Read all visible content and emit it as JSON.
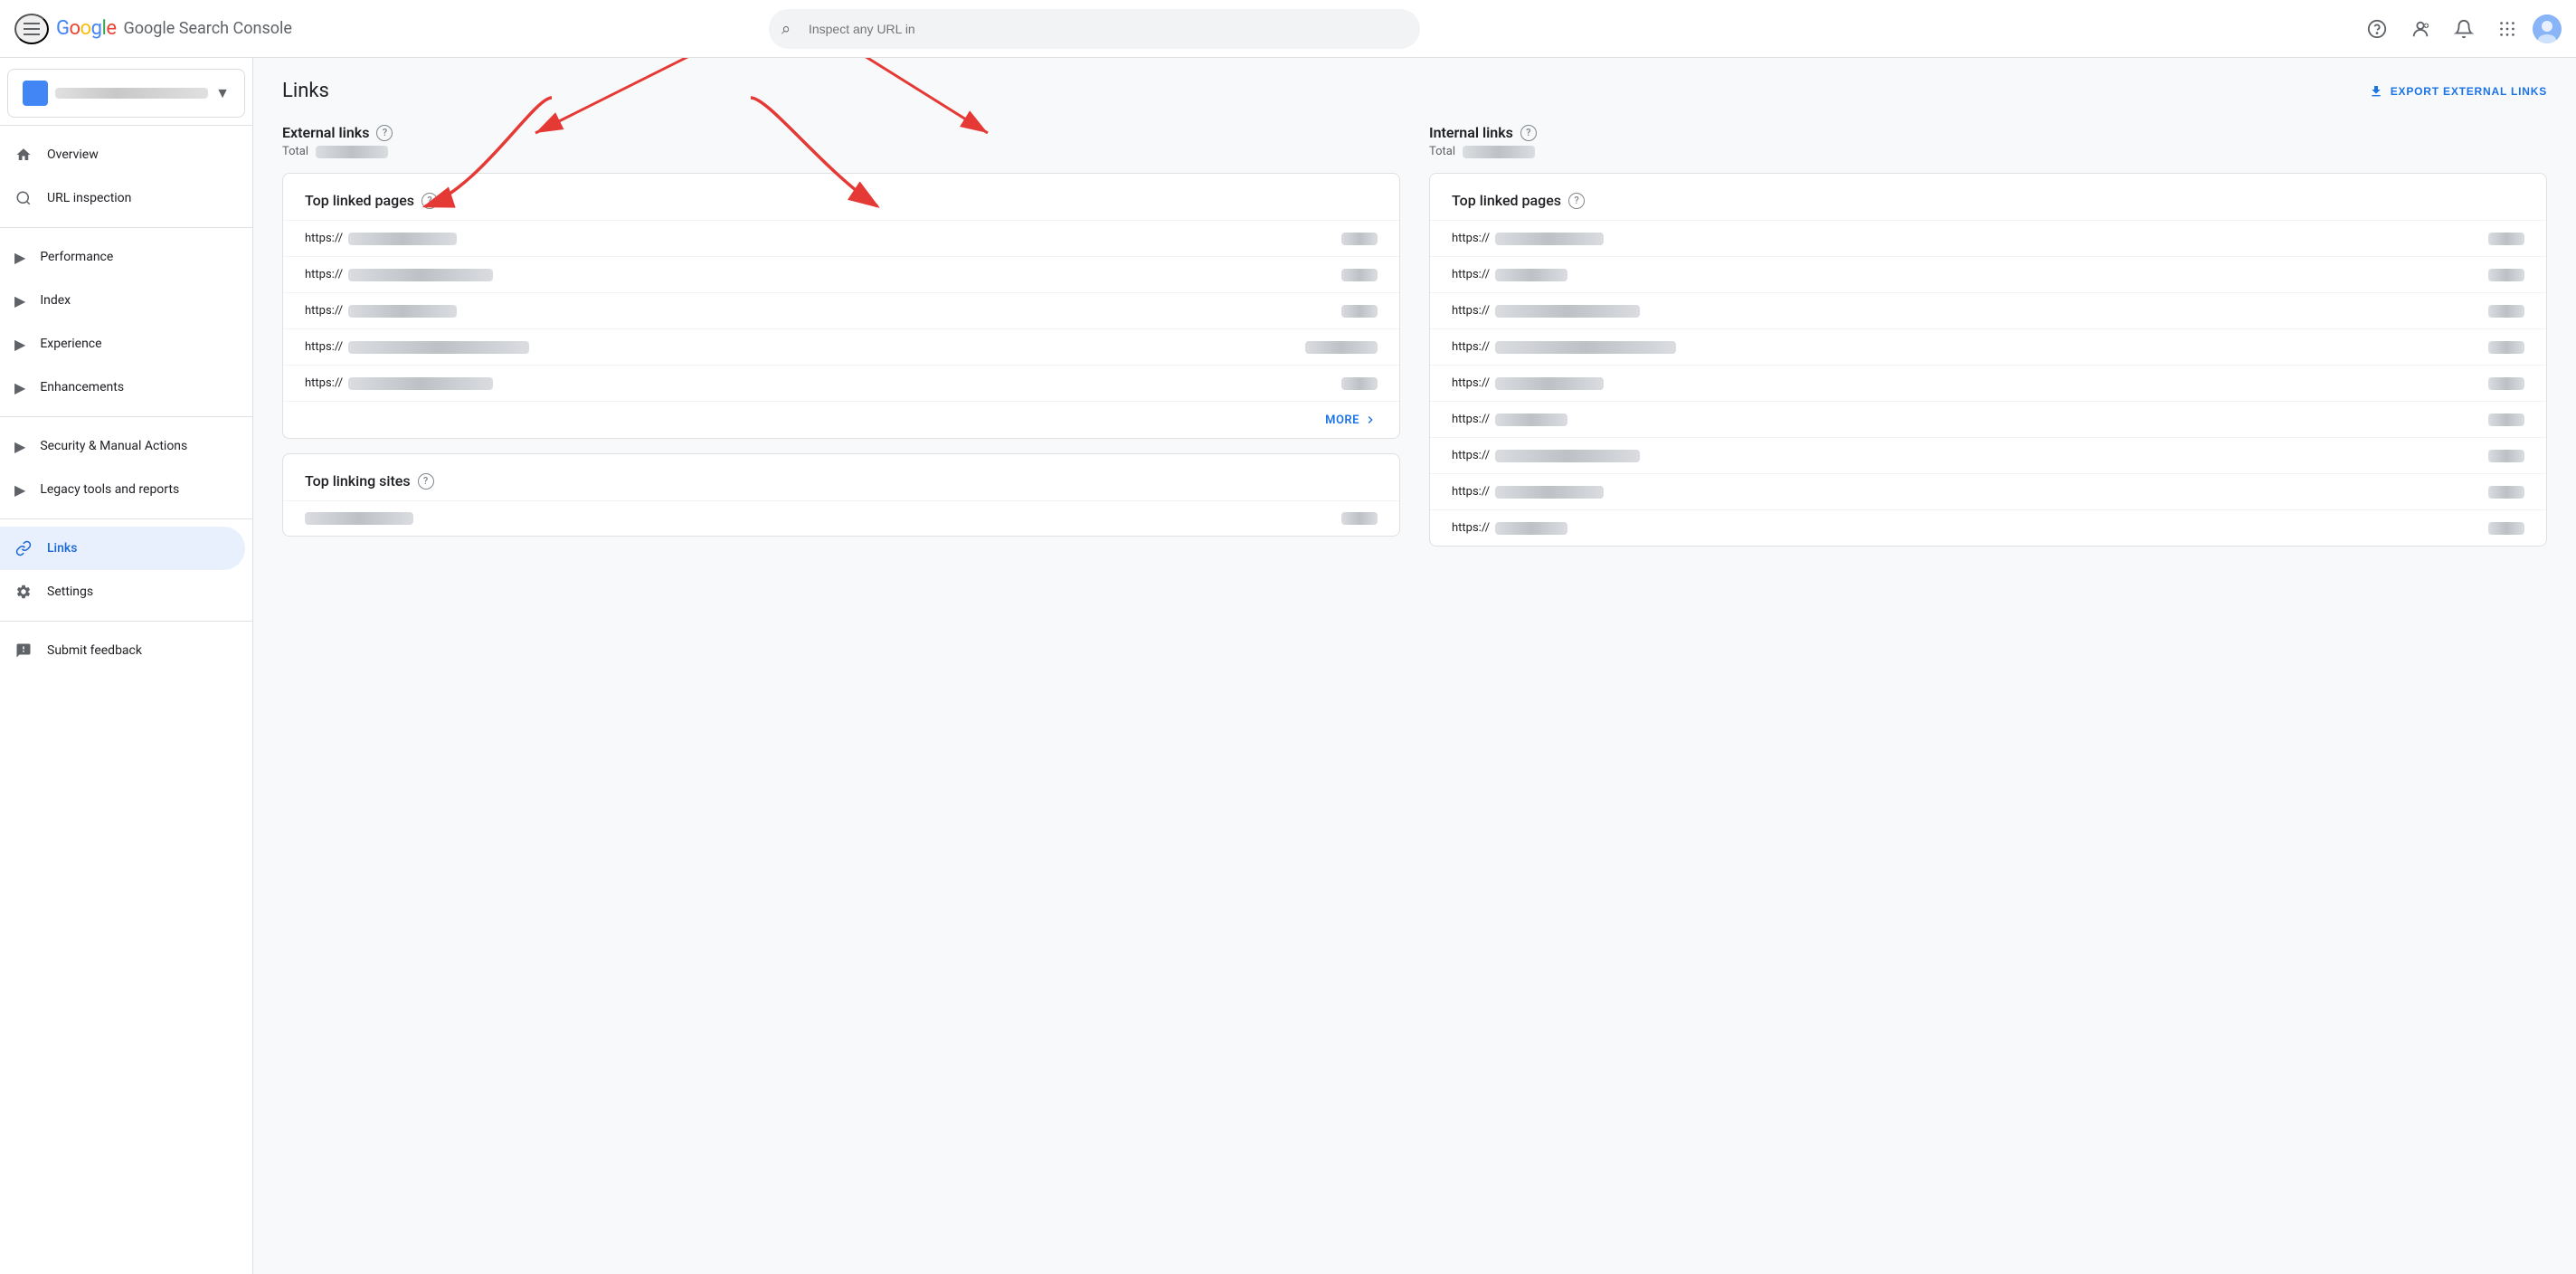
{
  "app": {
    "title": "Google Search Console",
    "logo_letters": [
      {
        "char": "G",
        "color": "#4285f4"
      },
      {
        "char": "o",
        "color": "#ea4335"
      },
      {
        "char": "o",
        "color": "#fbbc04"
      },
      {
        "char": "g",
        "color": "#4285f4"
      },
      {
        "char": "l",
        "color": "#34a853"
      },
      {
        "char": "e",
        "color": "#ea4335"
      }
    ]
  },
  "search": {
    "placeholder": "Inspect any URL in"
  },
  "sidebar": {
    "property_name": "Property",
    "items": [
      {
        "id": "overview",
        "label": "Overview",
        "icon": "home",
        "active": false
      },
      {
        "id": "url-inspection",
        "label": "URL inspection",
        "icon": "search",
        "active": false
      },
      {
        "id": "performance",
        "label": "Performance",
        "icon": "chart",
        "active": false,
        "group": true
      },
      {
        "id": "index",
        "label": "Index",
        "icon": "index",
        "active": false,
        "group": true
      },
      {
        "id": "experience",
        "label": "Experience",
        "icon": "experience",
        "active": false,
        "group": true
      },
      {
        "id": "enhancements",
        "label": "Enhancements",
        "icon": "enhance",
        "active": false,
        "group": true
      },
      {
        "id": "security",
        "label": "Security & Manual Actions",
        "icon": "security",
        "active": false,
        "group": true
      },
      {
        "id": "legacy",
        "label": "Legacy tools and reports",
        "icon": "legacy",
        "active": false,
        "group": true
      },
      {
        "id": "links",
        "label": "Links",
        "icon": "links",
        "active": true
      },
      {
        "id": "settings",
        "label": "Settings",
        "icon": "settings",
        "active": false
      }
    ],
    "submit_feedback": "Submit feedback"
  },
  "page": {
    "title": "Links",
    "export_btn": "EXPORT EXTERNAL LINKS"
  },
  "external_links": {
    "title": "External links",
    "total_label": "Total",
    "top_linked_title": "Top linked pages",
    "top_linking_title": "Top linking sites",
    "more_label": "MORE",
    "rows": [
      {
        "url_prefix": "https://",
        "value_width": 55
      },
      {
        "url_prefix": "https://",
        "value_width": 45
      },
      {
        "url_prefix": "https://",
        "value_width": 48
      },
      {
        "url_prefix": "https://",
        "value_width": 60
      },
      {
        "url_prefix": "https://",
        "value_width": 52
      }
    ]
  },
  "internal_links": {
    "title": "Internal links",
    "total_label": "Total",
    "top_linked_title": "Top linked pages",
    "rows": [
      {
        "url_prefix": "https://",
        "value_width": 42
      },
      {
        "url_prefix": "https://",
        "value_width": 50
      },
      {
        "url_prefix": "https://",
        "value_width": 44
      },
      {
        "url_prefix": "https://",
        "value_width": 58
      },
      {
        "url_prefix": "https://",
        "value_width": 46
      },
      {
        "url_prefix": "https://",
        "value_width": 40
      },
      {
        "url_prefix": "https://",
        "value_width": 55
      },
      {
        "url_prefix": "https://",
        "value_width": 43
      },
      {
        "url_prefix": "https://",
        "value_width": 49
      }
    ]
  }
}
